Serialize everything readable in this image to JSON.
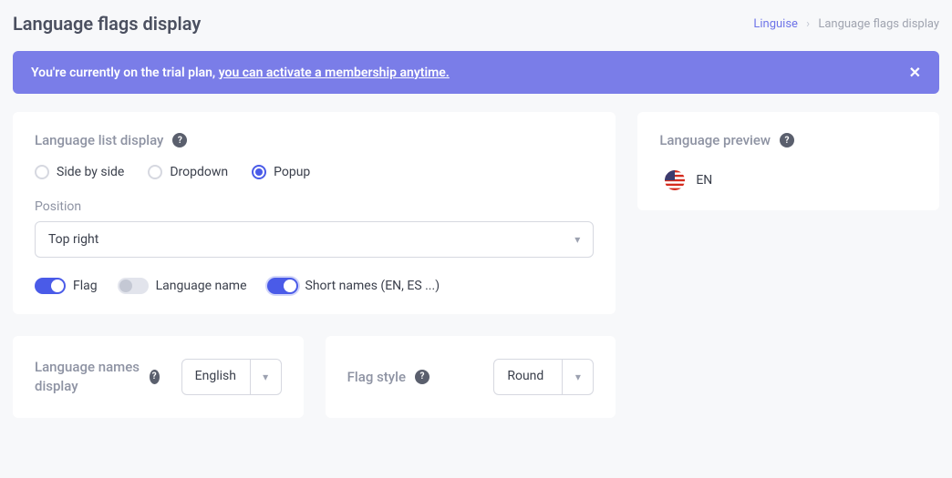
{
  "page": {
    "title": "Language flags display"
  },
  "breadcrumb": {
    "root": "Linguise",
    "current": "Language flags display"
  },
  "banner": {
    "prefix": "You're currently on the trial plan, ",
    "link": "you can activate a membership anytime."
  },
  "listDisplay": {
    "title": "Language list display",
    "options": {
      "sidebyside": "Side by side",
      "dropdown": "Dropdown",
      "popup": "Popup"
    },
    "positionLabel": "Position",
    "positionValue": "Top right",
    "toggles": {
      "flag": "Flag",
      "languageName": "Language name",
      "shortNames": "Short names (EN, ES ...)"
    }
  },
  "namesDisplay": {
    "title": "Language names display",
    "value": "English"
  },
  "flagStyle": {
    "title": "Flag style",
    "value": "Round"
  },
  "preview": {
    "title": "Language preview",
    "code": "EN"
  }
}
